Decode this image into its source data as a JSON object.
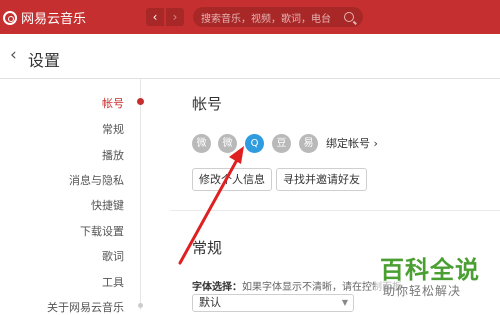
{
  "app": {
    "title": "网易云音乐"
  },
  "toolbar": {
    "back_glyph": "‹",
    "forward_glyph": "›"
  },
  "search": {
    "placeholder": "搜索音乐，视频，歌词，电台",
    "icon": "search-icon"
  },
  "page": {
    "title": "设置",
    "back_glyph": "‹"
  },
  "sidebar": {
    "items": [
      {
        "label": "帐号",
        "active": true
      },
      {
        "label": "常规"
      },
      {
        "label": "播放"
      },
      {
        "label": "消息与隐私"
      },
      {
        "label": "快捷键"
      },
      {
        "label": "下载设置"
      },
      {
        "label": "歌词"
      },
      {
        "label": "工具"
      },
      {
        "label": "关于网易云音乐"
      }
    ]
  },
  "account": {
    "title": "帐号",
    "social_icons": [
      "weibo-icon",
      "wechat-icon",
      "qq-icon",
      "douban-icon",
      "yixin-icon"
    ],
    "social_glyphs": [
      "微",
      "微",
      "Q",
      "豆",
      "易"
    ],
    "bind_label": "绑定帐号",
    "bind_chevron": "›",
    "edit_profile_label": "修改个人信息",
    "find_friends_label": "寻找并邀请好友"
  },
  "general": {
    "title": "常规",
    "font_label": "字体选择：",
    "font_hint": "如果字体显示不清晰，请在控制面板",
    "font_value": "默认"
  },
  "watermark": {
    "title": "百科全说",
    "subtitle": "助你轻松解决"
  },
  "colors": {
    "brand": "#c62f2f",
    "qq": "#2f9ce0",
    "arrow": "#e02020",
    "watermark": "#4a9f32"
  }
}
